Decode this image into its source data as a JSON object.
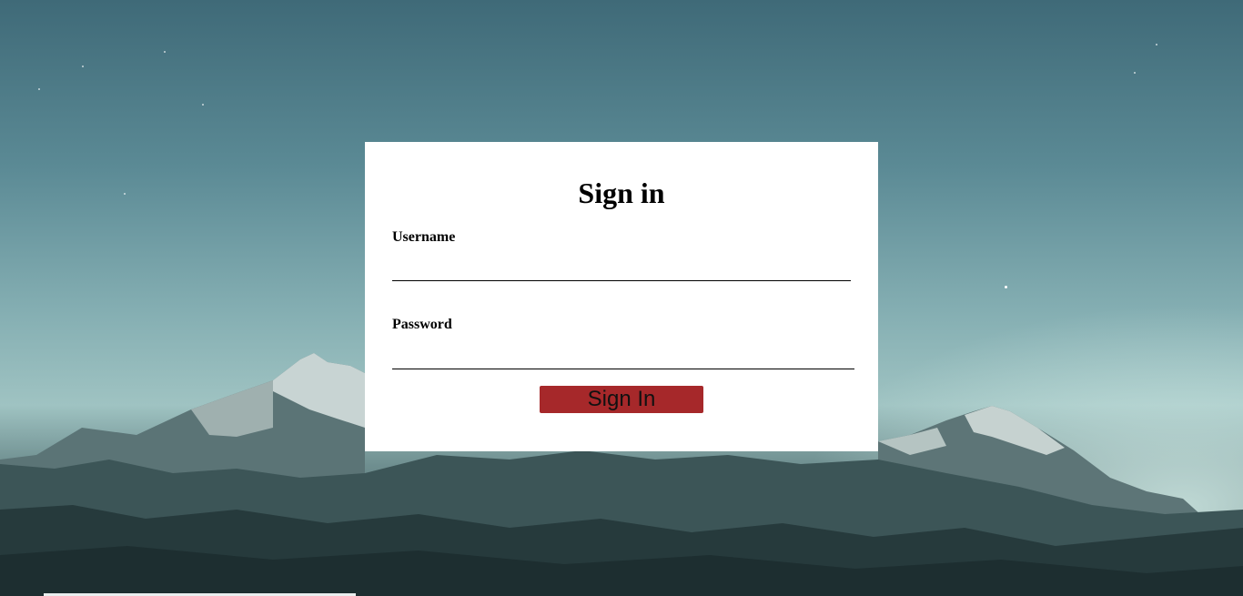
{
  "form": {
    "title": "Sign in",
    "username_label": "Username",
    "username_value": "",
    "password_label": "Password",
    "password_value": "",
    "submit_label": "Sign In"
  },
  "colors": {
    "card_background": "#ffffff",
    "button_background": "#a6282a",
    "underline": "#000000"
  }
}
